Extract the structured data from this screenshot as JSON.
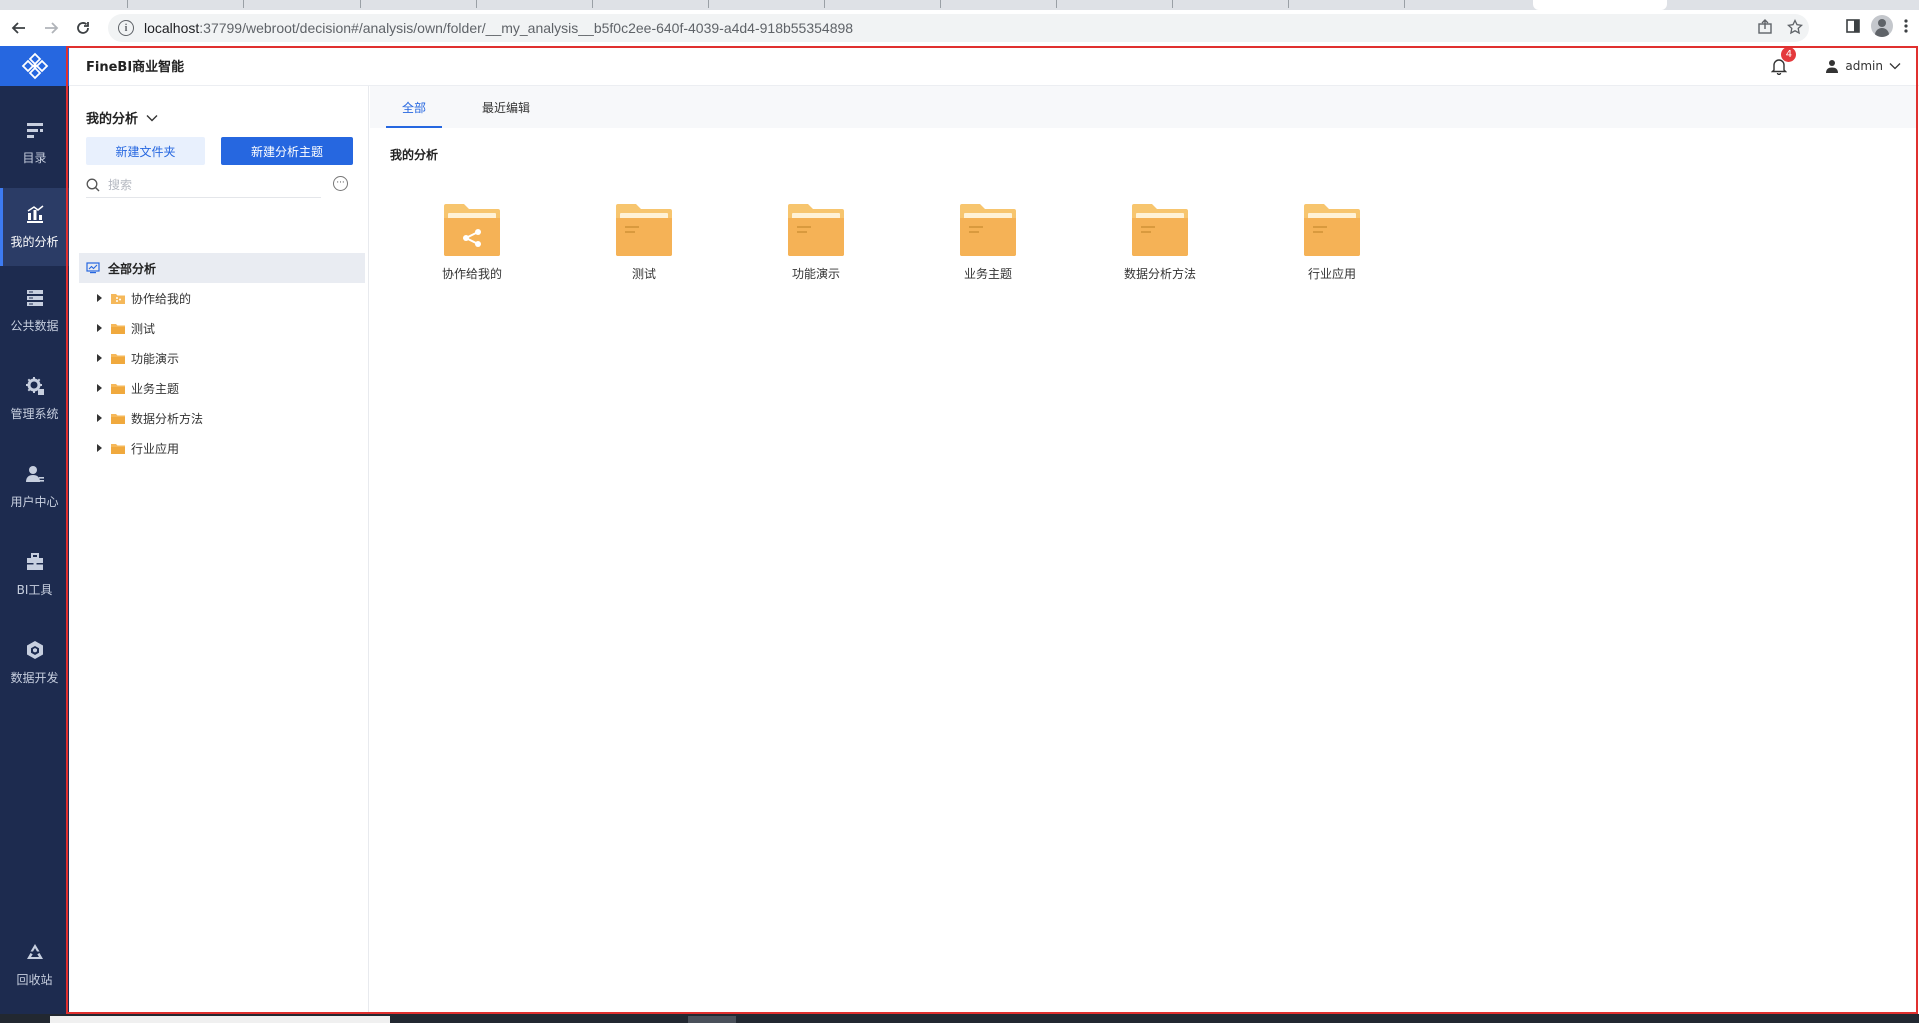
{
  "browser": {
    "url_host": "localhost",
    "url_path": ":37799/webroot/decision#/analysis/own/folder/__my_analysis__b5f0c2ee-640f-4039-a4d4-918b55354898"
  },
  "app": {
    "brand": "FineBI商业智能",
    "notification_count": "4",
    "user_name": "admin",
    "colors": {
      "nav_bg": "#1d2b4f",
      "primary": "#2667e0",
      "folder": "#f5b85a",
      "highlight_frame": "#e0302f"
    }
  },
  "left_nav": {
    "items": [
      {
        "label": "目录",
        "icon": "catalog-icon"
      },
      {
        "label": "我的分析",
        "icon": "analysis-chart-icon",
        "active": true
      },
      {
        "label": "公共数据",
        "icon": "database-icon"
      },
      {
        "label": "管理系统",
        "icon": "gear-icon"
      },
      {
        "label": "用户中心",
        "icon": "user-icon"
      },
      {
        "label": "BI工具",
        "icon": "toolbox-icon"
      },
      {
        "label": "数据开发",
        "icon": "cube-icon"
      }
    ],
    "recycle": {
      "label": "回收站",
      "icon": "recycle-icon"
    }
  },
  "panel": {
    "title": "我的分析",
    "new_folder_label": "新建文件夹",
    "new_topic_label": "新建分析主题",
    "search_placeholder": "搜索",
    "tree_root": "全部分析",
    "tree_items": [
      {
        "label": "协作给我的"
      },
      {
        "label": "测试"
      },
      {
        "label": "功能演示"
      },
      {
        "label": "业务主题"
      },
      {
        "label": "数据分析方法"
      },
      {
        "label": "行业应用"
      }
    ]
  },
  "main": {
    "tabs": [
      {
        "label": "全部",
        "active": true
      },
      {
        "label": "最近编辑",
        "active": false
      }
    ],
    "section_title": "我的分析",
    "folders": [
      {
        "label": "协作给我的",
        "shared": true
      },
      {
        "label": "测试"
      },
      {
        "label": "功能演示"
      },
      {
        "label": "业务主题"
      },
      {
        "label": "数据分析方法"
      },
      {
        "label": "行业应用"
      }
    ]
  }
}
